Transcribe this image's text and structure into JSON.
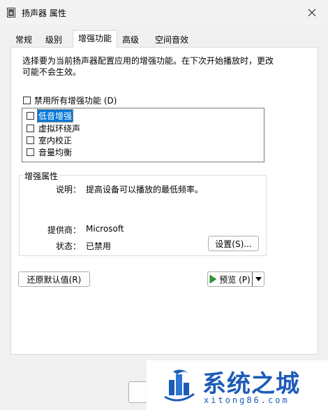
{
  "window": {
    "title": "扬声器 属性"
  },
  "tabs": [
    {
      "label": "常规"
    },
    {
      "label": "级别"
    },
    {
      "label": "增强功能",
      "active": true
    },
    {
      "label": "高级"
    },
    {
      "label": "空间音效"
    }
  ],
  "description": "选择要为当前扬声器配置应用的增强功能。在下次开始播放时，更改可能不会生效。",
  "disable_all": {
    "label": "禁用所有增强功能 (D)",
    "checked": false
  },
  "enhancements": [
    {
      "label": "低音增强",
      "checked": false,
      "selected": true
    },
    {
      "label": "虚拟环绕声",
      "checked": false,
      "selected": false
    },
    {
      "label": "室内校正",
      "checked": false,
      "selected": false
    },
    {
      "label": "音量均衡",
      "checked": false,
      "selected": false
    }
  ],
  "properties": {
    "group_title": "增强属性",
    "description_label": "说明：",
    "description_value": "提高设备可以播放的最低频率。",
    "provider_label": "提供商：",
    "provider_value": "Microsoft",
    "status_label": "状态：",
    "status_value": "已禁用",
    "settings_button": "设置(S)..."
  },
  "buttons": {
    "restore_defaults": "还原默认值(R)",
    "preview": "预览 (P)"
  },
  "watermark": {
    "title": "系统之城",
    "subtitle": "xitong86.com"
  },
  "colors": {
    "selection": "#0078d7",
    "play_green": "#2e9e2e",
    "watermark_blue": "#1e5bb8"
  }
}
